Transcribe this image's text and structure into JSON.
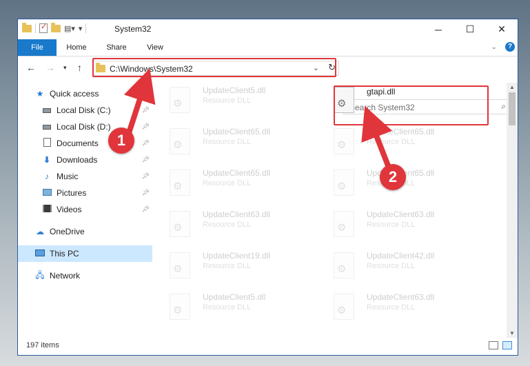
{
  "window": {
    "title": "System32",
    "buttons": {
      "minimize": "─",
      "maximize": "☐",
      "close": "✕"
    }
  },
  "ribbon": {
    "tabs": [
      "File",
      "Home",
      "Share",
      "View"
    ],
    "help": "?",
    "collapse": "⌄"
  },
  "address": {
    "path": "C:\\Windows\\System32",
    "search_placeholder": "Search System32"
  },
  "nav": {
    "items": [
      {
        "label": "Quick access",
        "icon": "star-icon",
        "pinned": false
      },
      {
        "label": "Local Disk (C:)",
        "icon": "drive-icon",
        "pinned": true
      },
      {
        "label": "Local Disk (D:)",
        "icon": "drive-icon",
        "pinned": true
      },
      {
        "label": "Documents",
        "icon": "documents-icon",
        "pinned": true
      },
      {
        "label": "Downloads",
        "icon": "downloads-icon",
        "pinned": true
      },
      {
        "label": "Music",
        "icon": "music-icon",
        "pinned": true
      },
      {
        "label": "Pictures",
        "icon": "pictures-icon",
        "pinned": true
      },
      {
        "label": "Videos",
        "icon": "videos-icon",
        "pinned": true
      },
      {
        "label": "OneDrive",
        "icon": "onedrive-icon",
        "pinned": false
      },
      {
        "label": "This PC",
        "icon": "this-pc-icon",
        "pinned": false,
        "selected": true
      },
      {
        "label": "Network",
        "icon": "network-icon",
        "pinned": false
      }
    ]
  },
  "files": {
    "highlighted": {
      "name": "gtapi.dll",
      "type": ""
    },
    "left_column": [
      {
        "name": "UpdateClient5.dll",
        "type": "Resource DLL"
      },
      {
        "name": "UpdateClient65.dll",
        "type": "Resource DLL"
      },
      {
        "name": "UpdateClient65.dll",
        "type": "Resource DLL"
      },
      {
        "name": "UpdateClient63.dll",
        "type": "Resource DLL"
      },
      {
        "name": "UpdateClient19.dll",
        "type": "Resource DLL"
      },
      {
        "name": "UpdateClient5.dll",
        "type": "Resource DLL"
      }
    ],
    "right_column": [
      {
        "name": "UpdateClient65.dll",
        "type": "Resource DLL"
      },
      {
        "name": "UpdateClient65.dll",
        "type": "Resource DLL"
      },
      {
        "name": "UpdateClient63.dll",
        "type": "Resource DLL"
      },
      {
        "name": "UpdateClient42.dll",
        "type": "Resource DLL"
      },
      {
        "name": "UpdateClient63.dll",
        "type": "Resource DLL"
      }
    ]
  },
  "status": {
    "item_count": "197 items"
  },
  "annotations": [
    {
      "number": "1",
      "color": "#e0353b"
    },
    {
      "number": "2",
      "color": "#e0353b"
    }
  ]
}
